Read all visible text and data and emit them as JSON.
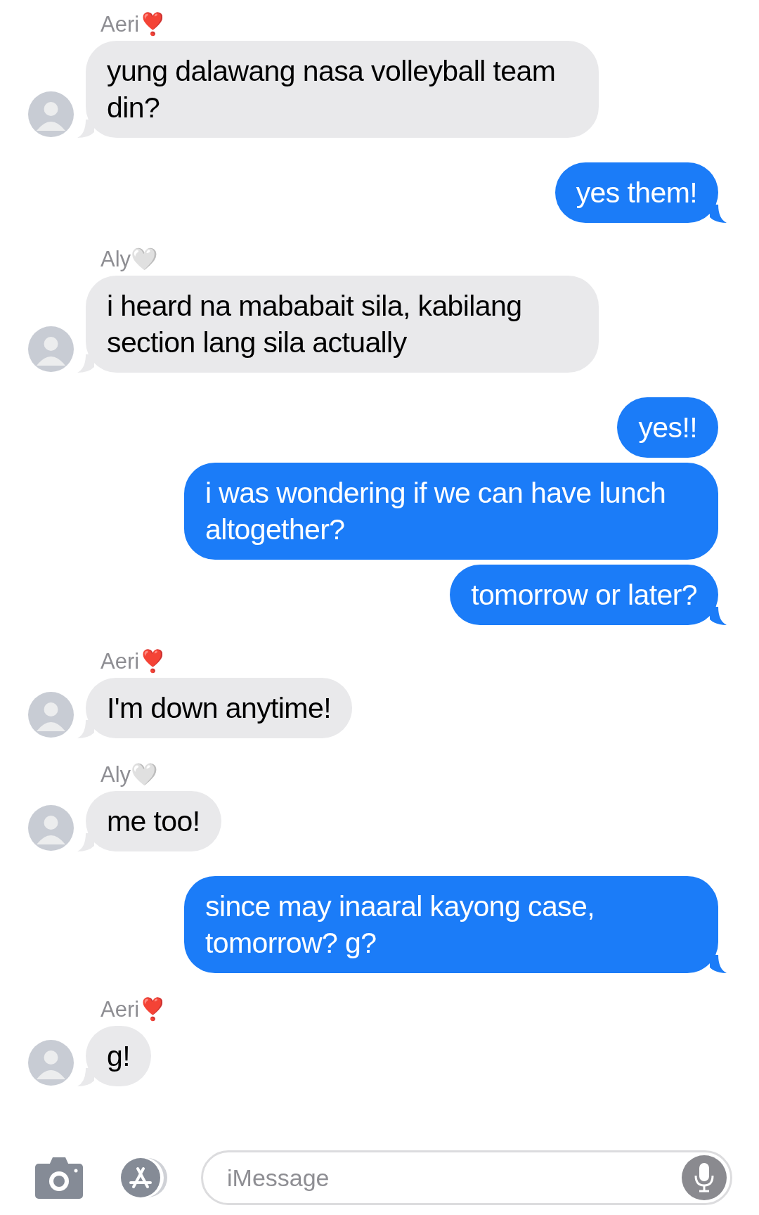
{
  "messages": [
    {
      "kind": "incoming",
      "sender": "Aeri❣️",
      "text": "yung dalawang nasa volleyball team din?",
      "tail": true
    },
    {
      "kind": "outgoing",
      "text": "yes them!",
      "tail": true
    },
    {
      "kind": "incoming",
      "sender": "Aly🤍",
      "text": "i heard na mababait sila, kabilang section lang sila actually",
      "tail": true
    },
    {
      "kind": "outgoing",
      "text": "yes!!",
      "tail": false
    },
    {
      "kind": "outgoing",
      "text": "i was wondering if we can have lunch altogether?",
      "tail": false
    },
    {
      "kind": "outgoing",
      "text": "tomorrow or later?",
      "tail": true
    },
    {
      "kind": "incoming",
      "sender": "Aeri❣️",
      "text": "I'm down anytime!",
      "tail": true
    },
    {
      "kind": "incoming",
      "sender": "Aly🤍",
      "text": "me too!",
      "tail": true
    },
    {
      "kind": "outgoing",
      "text": "since may inaaral kayong case, tomorrow? g?",
      "tail": true
    },
    {
      "kind": "incoming",
      "sender": "Aeri❣️",
      "text": "g!",
      "tail": true
    }
  ],
  "composer": {
    "placeholder": "iMessage"
  }
}
